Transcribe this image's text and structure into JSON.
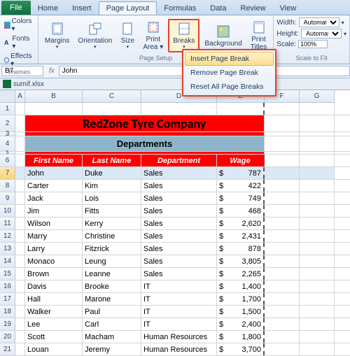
{
  "tabs": {
    "file": "File",
    "home": "Home",
    "insert": "Insert",
    "pagelayout": "Page Layout",
    "formulas": "Formulas",
    "data": "Data",
    "review": "Review",
    "view": "View"
  },
  "ribbon": {
    "themes": {
      "colors": "Colors ▾",
      "fonts": "Fonts ▾",
      "effects": "Effects ▾",
      "label": "Themes"
    },
    "pagesetup": {
      "margins": "Margins",
      "orientation": "Orientation",
      "size": "Size",
      "printarea": "Print\nArea ▾",
      "breaks": "Breaks",
      "background": "Background",
      "printtitles": "Print\nTitles",
      "label": "Page Setup"
    },
    "scale": {
      "width": "Width:",
      "height": "Height:",
      "scale": "Scale:",
      "auto": "Automatic",
      "pct": "100%",
      "label": "Scale to Fit"
    }
  },
  "menu": {
    "insert": "Insert Page Break",
    "remove": "Remove Page Break",
    "reset": "Reset All Page Breaks"
  },
  "namebox": "B7",
  "formula": "John",
  "filename": "sumif.xlsx",
  "cols": [
    "A",
    "B",
    "C",
    "D",
    "E",
    "F",
    "G"
  ],
  "title": "RedZone Tyre Company",
  "subtitle": "Departments",
  "headers": {
    "b": "First Name",
    "c": "Last Name",
    "d": "Department",
    "e": "Wage"
  },
  "rows": [
    {
      "n": 7,
      "b": "John",
      "c": "Duke",
      "d": "Sales",
      "e": "787",
      "sel": true
    },
    {
      "n": 8,
      "b": "Carter",
      "c": "Kim",
      "d": "Sales",
      "e": "422"
    },
    {
      "n": 9,
      "b": "Jack",
      "c": "Lois",
      "d": "Sales",
      "e": "749"
    },
    {
      "n": 10,
      "b": "Jim",
      "c": "Fitts",
      "d": "Sales",
      "e": "468"
    },
    {
      "n": 11,
      "b": "Wilson",
      "c": "Kerry",
      "d": "Sales",
      "e": "2,620"
    },
    {
      "n": 12,
      "b": "Marry",
      "c": "Christine",
      "d": "Sales",
      "e": "2,431"
    },
    {
      "n": 13,
      "b": "Larry",
      "c": "Fitzrick",
      "d": "Sales",
      "e": "878"
    },
    {
      "n": 14,
      "b": "Monaco",
      "c": "Leung",
      "d": "Sales",
      "e": "3,805"
    },
    {
      "n": 15,
      "b": "Brown",
      "c": "Leanne",
      "d": "Sales",
      "e": "2,265"
    },
    {
      "n": 16,
      "b": "Davis",
      "c": "Brooke",
      "d": "IT",
      "e": "1,400"
    },
    {
      "n": 17,
      "b": "Hall",
      "c": "Marone",
      "d": "IT",
      "e": "1,700"
    },
    {
      "n": 18,
      "b": "Walker",
      "c": "Paul",
      "d": "IT",
      "e": "1,500"
    },
    {
      "n": 19,
      "b": "Lee",
      "c": "Carl",
      "d": "IT",
      "e": "2,400"
    },
    {
      "n": 20,
      "b": "Scott",
      "c": "Macham",
      "d": "Human Resources",
      "e": "1,800"
    },
    {
      "n": 21,
      "b": "Louan",
      "c": "Jeremy",
      "d": "Human Resources",
      "e": "3,700"
    }
  ]
}
